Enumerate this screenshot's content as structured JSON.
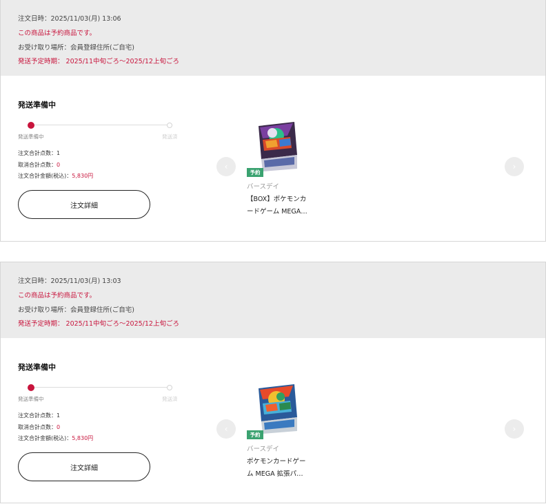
{
  "orders": [
    {
      "order_datetime": "注文日時：2025/11/03(月) 13:06",
      "preorder_notice": "この商品は予約商品です。",
      "pickup_location": "お受け取り場所：会員登録住所(ご自宅)",
      "ship_schedule": "発送予定時期： 2025/11中旬ごろ〜2025/12上旬ごろ",
      "status": "発送準備中",
      "progress_start": "発送準備中",
      "progress_end": "発送済",
      "total_items_label": "注文合計点数：",
      "total_items": "1",
      "cancelled_label": "取消合計点数：",
      "cancelled": "0",
      "total_amount_label": "注文合計金額(税込)：",
      "total_amount": "5,830円",
      "detail_button": "注文詳細",
      "prev_icon": "‹",
      "next_icon": "›",
      "product": {
        "badge": "予約",
        "brand": "バースデイ",
        "name_line1": "【BOX】ポケモンカ",
        "name_line2": "ードゲーム MEGA…"
      }
    },
    {
      "order_datetime": "注文日時：2025/11/03(月) 13:03",
      "preorder_notice": "この商品は予約商品です。",
      "pickup_location": "お受け取り場所：会員登録住所(ご自宅)",
      "ship_schedule": "発送予定時期： 2025/11中旬ごろ〜2025/12上旬ごろ",
      "status": "発送準備中",
      "progress_start": "発送準備中",
      "progress_end": "発送済",
      "total_items_label": "注文合計点数：",
      "total_items": "1",
      "cancelled_label": "取消合計点数：",
      "cancelled": "0",
      "total_amount_label": "注文合計金額(税込)：",
      "total_amount": "5,830円",
      "detail_button": "注文詳細",
      "prev_icon": "‹",
      "next_icon": "›",
      "product": {
        "badge": "予約",
        "brand": "バースデイ",
        "name_line1": "ポケモンカードゲー",
        "name_line2": "ム MEGA 拡張パ…"
      }
    }
  ],
  "colors": {
    "accent": "#c8143c",
    "badge": "#3aa270",
    "header_bg": "#ebebeb"
  }
}
